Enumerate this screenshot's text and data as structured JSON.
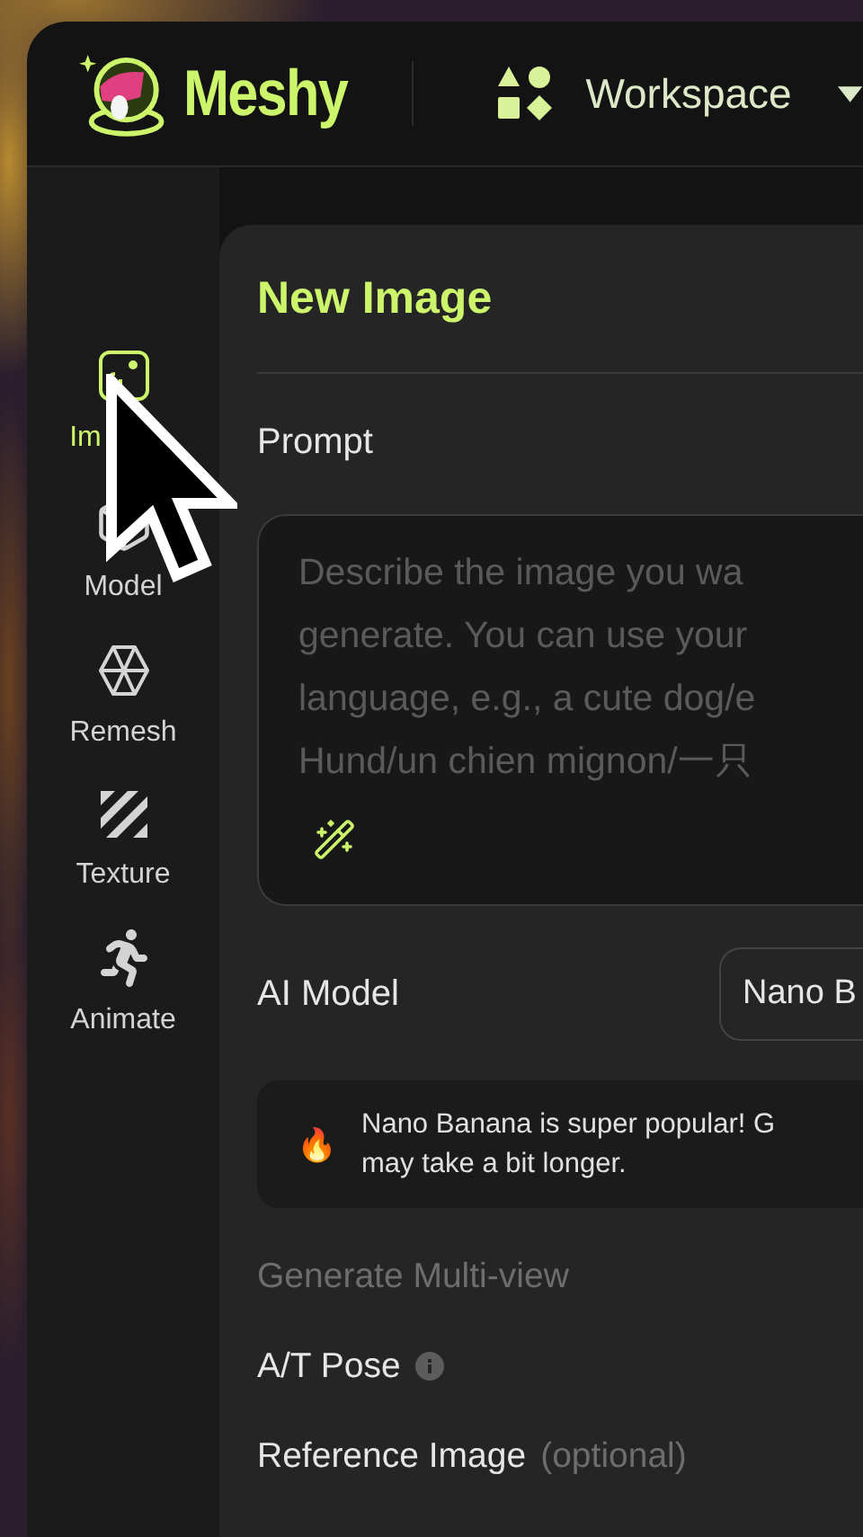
{
  "header": {
    "brand": "Meshy",
    "workspace": "Workspace"
  },
  "sidebar": {
    "items": [
      {
        "kind": "image",
        "label": "Im",
        "selected": true
      },
      {
        "kind": "model",
        "label": "Model",
        "selected": false
      },
      {
        "kind": "remesh",
        "label": "Remesh",
        "selected": false
      },
      {
        "kind": "texture",
        "label": "Texture",
        "selected": false
      },
      {
        "kind": "animate",
        "label": "Animate",
        "selected": false
      }
    ]
  },
  "panel": {
    "title": "New Image",
    "prompt": {
      "label": "Prompt",
      "placeholder_lines": [
        "Describe the image you wa",
        "generate. You can use your",
        "language, e.g., a cute dog/e",
        "Hund/un chien mignon/一只"
      ]
    },
    "ai_model": {
      "label": "AI Model",
      "value": "Nano B"
    },
    "notice": {
      "emoji": "🔥",
      "lines": [
        "Nano Banana is super popular! G",
        "may take a bit longer."
      ]
    },
    "options": [
      {
        "kind": "section",
        "label": "Generate Multi-view",
        "disabled": true
      },
      {
        "kind": "info",
        "label": "A/T Pose",
        "disabled": false
      },
      {
        "kind": "hint",
        "label": "Reference Image",
        "hint": "(optional)",
        "disabled": false
      }
    ]
  }
}
